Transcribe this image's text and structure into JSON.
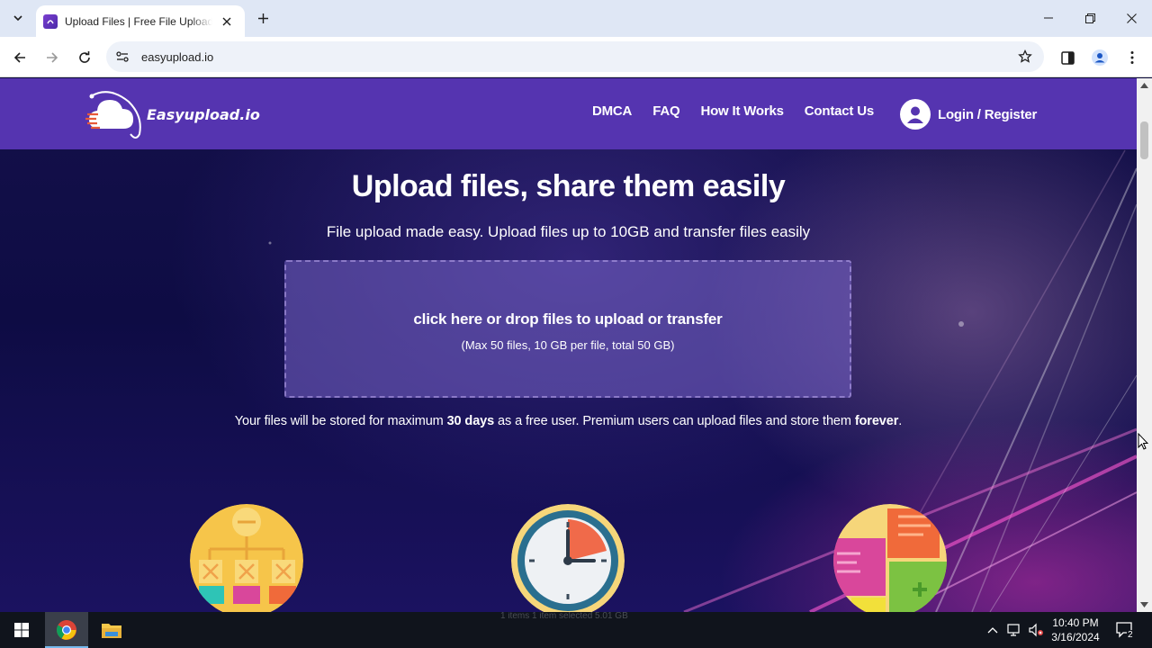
{
  "browser": {
    "tab_title": "Upload Files | Free File Upload and Transfer",
    "url": "easyupload.io"
  },
  "site": {
    "logo_text": "Easyupload.io",
    "nav": [
      "DMCA",
      "FAQ",
      "How It Works",
      "Contact Us"
    ],
    "login_label": "Login / Register"
  },
  "hero": {
    "title": "Upload files, share them easily",
    "subtitle": "File upload made easy. Upload files up to 10GB and transfer files easily"
  },
  "dropzone": {
    "main": "click here or drop files to upload or transfer",
    "note": "(Max 50 files, 10 GB per file, total 50 GB)"
  },
  "storage_note": {
    "part1": "Your files will be stored for maximum ",
    "days": "30 days",
    "part2": " as a free user. Premium users can upload files and store them ",
    "forever": "forever",
    "part3": "."
  },
  "features": [
    "sitemap-icon",
    "clock-icon",
    "puzzle-icon"
  ],
  "taskbar": {
    "explorer_status": "1 items      1 item selected  5.01 GB",
    "time": "10:40 PM",
    "date": "3/16/2024",
    "notification_count": "2"
  },
  "colors": {
    "header": "#5534b0",
    "tabbar": "#dfe7f5",
    "page_bg": "#0e0c44"
  }
}
